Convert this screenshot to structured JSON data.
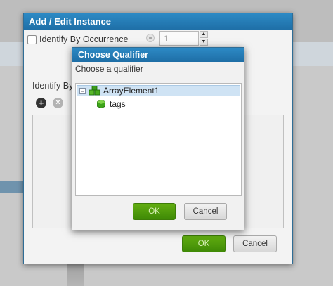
{
  "outer_dialog": {
    "title": "Add / Edit Instance",
    "identify_by_occurrence_label": "Identify By Occurrence",
    "occurrence_value": "1",
    "identify_by_label": "Identify By",
    "ok_label": "OK",
    "cancel_label": "Cancel"
  },
  "inner_dialog": {
    "title": "Choose Qualifier",
    "prompt": "Choose a qualifier",
    "tree": [
      {
        "label": "ArrayElement1",
        "icon": "cubes-icon",
        "expanded": true,
        "selected": true
      },
      {
        "label": "tags",
        "icon": "cube-icon"
      }
    ],
    "ok_label": "OK",
    "cancel_label": "Cancel"
  },
  "colors": {
    "title_bar": "#1e6ea6",
    "ok_button": "#4a960a",
    "selection": "#cfe3f4"
  }
}
